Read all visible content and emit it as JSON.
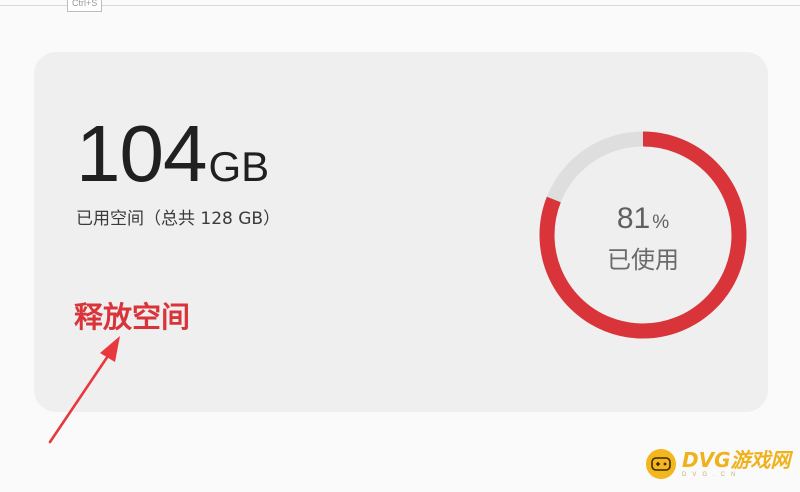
{
  "tooltip": {
    "shortcut": "Ctrl+S"
  },
  "storage": {
    "used_value": "104",
    "used_unit": "GB",
    "caption": "已用空间（总共 128 GB）",
    "action_label": "释放空间",
    "usage_fraction": 0.81,
    "ring_percent": "81",
    "ring_percent_sign": "%",
    "ring_label": "已使用",
    "colors": {
      "used": "#d8343a",
      "remaining": "#dedede",
      "card": "#efefef",
      "action": "#d8343a"
    }
  },
  "annotation": {
    "arrow_color": "#e8383d",
    "arrow_icon": "arrow-annotation"
  },
  "watermark": {
    "brand": "DVG游戏网",
    "site": "DVG.CN",
    "icon": "gamepad-icon",
    "color": "#f0b21c"
  }
}
